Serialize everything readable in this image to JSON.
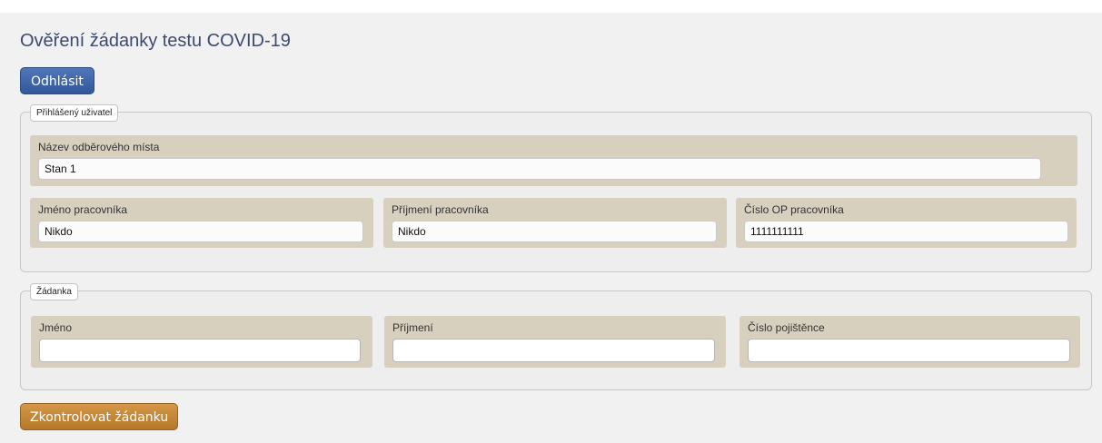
{
  "title": "Ověření žádanky testu COVID-19",
  "buttons": {
    "logout": "Odhlásit",
    "check": "Zkontrolovat žádanku"
  },
  "logged_user": {
    "legend": "Přihlášený uživatel",
    "site_label": "Název odběrového místa",
    "site_value": "Stan 1",
    "first_name_label": "Jméno pracovníka",
    "first_name_value": "Nikdo",
    "last_name_label": "Příjmení pracovníka",
    "last_name_value": "Nikdo",
    "id_label": "Číslo OP pracovníka",
    "id_value": "1111111111"
  },
  "request": {
    "legend": "Žádanka",
    "first_name_label": "Jméno",
    "first_name_value": "",
    "last_name_label": "Příjmení",
    "last_name_value": "",
    "insurance_label": "Číslo pojištěnce",
    "insurance_value": ""
  },
  "colors": {
    "logout_button": "#3f66a9",
    "check_button": "#c7893a",
    "panel": "#d8d0bf",
    "title": "#3d4a70"
  }
}
